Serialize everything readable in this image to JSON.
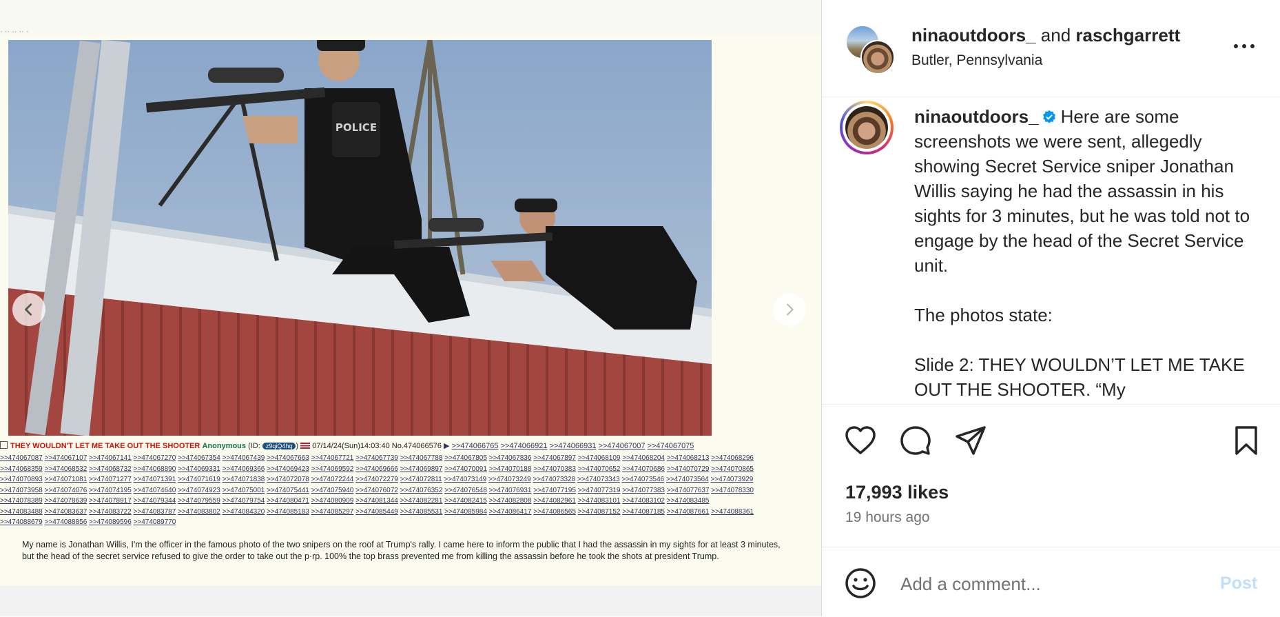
{
  "media": {
    "thread_subject": "THEY WOULDN'T LET ME TAKE OUT THE SHOOTER",
    "poster_name": "Anonymous",
    "id_prefix": "(ID:",
    "id_value": "z9qiQ4hq",
    "id_suffix": ")",
    "datetime": "07/14/24(Sun)14:03:40",
    "post_no": "No.474066576",
    "replies": [
      [
        ">>474066765",
        ">>474066921",
        ">>474066931",
        ">>474067007",
        ">>474067075"
      ],
      [
        ">>474067087",
        ">>474067107",
        ">>474067141",
        ">>474067270",
        ">>474067354",
        ">>474067439",
        ">>474067663",
        ">>474067721",
        ">>474067739",
        ">>474067788",
        ">>474067805",
        ">>474067836",
        ">>474067897",
        ">>474068109",
        ">>474068204",
        ">>474068213",
        ">>474068296"
      ],
      [
        ">>474068359",
        ">>474068532",
        ">>474068732",
        ">>474068890",
        ">>474069331",
        ">>474069366",
        ">>474069423",
        ">>474069592",
        ">>474069666",
        ">>474069897",
        ">>474070091",
        ">>474070188",
        ">>474070383",
        ">>474070652",
        ">>474070686",
        ">>474070729",
        ">>474070865"
      ],
      [
        ">>474070893",
        ">>474071081",
        ">>474071277",
        ">>474071391",
        ">>474071619",
        ">>474071838",
        ">>474072078",
        ">>474072244",
        ">>474072279",
        ">>474072811",
        ">>474073149",
        ">>474073249",
        ">>474073328",
        ">>474073343",
        ">>474073546",
        ">>474073564",
        ">>474073929"
      ],
      [
        ">>474073958",
        ">>474074076",
        ">>474074195",
        ">>474074640",
        ">>474074923",
        ">>474075001",
        ">>474075441",
        ">>474075940",
        ">>474076072",
        ">>474076352",
        ">>474076548",
        ">>474076931",
        ">>474077195",
        ">>474077319",
        ">>474077383",
        ">>474077637",
        ">>474078330"
      ],
      [
        ">>474078389",
        ">>474078639",
        ">>474078917",
        ">>474079344",
        ">>474079559",
        ">>474079754",
        ">>474080471",
        ">>474080909",
        ">>474081344",
        ">>474082281",
        ">>474082415",
        ">>474082808",
        ">>474082961",
        ">>474083101",
        ">>474083102",
        ">>474083485"
      ],
      [
        ">>474083488",
        ">>474083637",
        ">>474083722",
        ">>474083787",
        ">>474083802",
        ">>474084320",
        ">>474085183",
        ">>474085297",
        ">>474085449",
        ">>474085531",
        ">>474085984",
        ">>474086417",
        ">>474086565",
        ">>474087152",
        ">>474087185",
        ">>474087661",
        ">>474088361"
      ],
      [
        ">>474088679",
        ">>474088856",
        ">>474089596",
        ">>474089770"
      ]
    ],
    "post_body": "My name is Jonathan Willis, I'm the officer in the famous photo of the two snipers on the roof at Trump's rally. I came here to inform the public that I had the assassin in my sights for at least 3 minutes, but the head of the secret service refused to give the order to take out the p·rp. 100% the top brass prevented me from killing the assassin before he took the shots at president Trump.",
    "vest_text": "POLICE",
    "icons": {
      "prev": "chevron-left-icon",
      "next": "chevron-right-icon"
    }
  },
  "header": {
    "user1": "ninaoutdoors_",
    "joiner": " and ",
    "user2": "raschgarrett",
    "location": "Butler, Pennsylvania"
  },
  "caption": {
    "username": "ninaoutdoors_",
    "text": "Here are some screenshots we were sent, allegedly showing Secret Service sniper Jonathan Willis saying he had the assassin in his sights for 3 minutes, but he was told not to engage by the head of the Secret Service unit.\n\nThe photos state:\n\nSlide 2: THEY WOULDN’T LET ME TAKE OUT THE SHOOTER. “My"
  },
  "actions": {
    "likes": "17,993 likes",
    "time_ago": "19 hours ago",
    "icons": [
      "heart-icon",
      "comment-icon",
      "share-icon",
      "bookmark-icon"
    ]
  },
  "comment": {
    "placeholder": "Add a comment...",
    "post_label": "Post"
  },
  "colors": {
    "accent_post_disabled": "#c0dffd",
    "verified_blue": "#0095f6",
    "subject_red": "#cc1105",
    "name_green": "#117743"
  }
}
